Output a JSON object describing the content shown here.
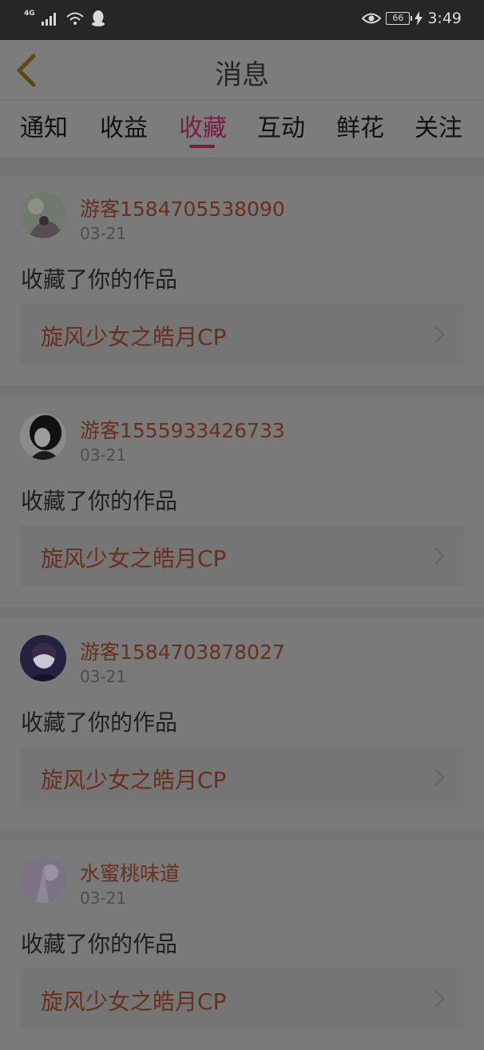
{
  "status_bar": {
    "network": "4G",
    "battery": "66",
    "time": "3:49"
  },
  "header": {
    "title": "消息"
  },
  "tabs": [
    {
      "label": "通知"
    },
    {
      "label": "收益"
    },
    {
      "label": "收藏"
    },
    {
      "label": "互动"
    },
    {
      "label": "鲜花"
    },
    {
      "label": "关注"
    }
  ],
  "active_tab": "收藏",
  "messages": [
    {
      "username": "游客1584705538090",
      "date": "03-21",
      "action": "收藏了你的作品",
      "work_title": "旋风少女之皓月CP"
    },
    {
      "username": "游客1555933426733",
      "date": "03-21",
      "action": "收藏了你的作品",
      "work_title": "旋风少女之皓月CP"
    },
    {
      "username": "游客1584703878027",
      "date": "03-21",
      "action": "收藏了你的作品",
      "work_title": "旋风少女之皓月CP"
    },
    {
      "username": "水蜜桃味道",
      "date": "03-21",
      "action": "收藏了你的作品",
      "work_title": "旋风少女之皓月CP"
    }
  ]
}
